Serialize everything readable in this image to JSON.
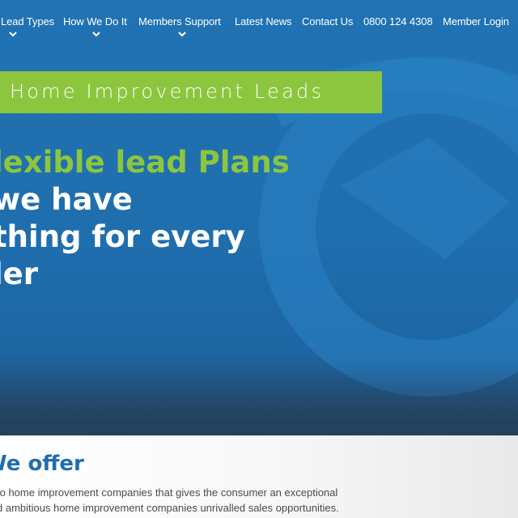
{
  "nav": {
    "items": [
      {
        "label": "Lead Types",
        "has_dropdown": true
      },
      {
        "label": "How We Do It",
        "has_dropdown": true
      },
      {
        "label": "Members Support",
        "has_dropdown": true
      },
      {
        "label": "Latest News",
        "has_dropdown": false
      },
      {
        "label": "Contact Us",
        "has_dropdown": false
      },
      {
        "label": "0800 124 4308",
        "has_dropdown": false
      },
      {
        "label": "Member Login",
        "has_dropdown": false
      }
    ]
  },
  "hero": {
    "banner": "Home Improvement Leads",
    "headline_line1": "lexible lead Plans",
    "headline_line2": " we have",
    "headline_line3": "thing for every",
    "headline_line4": "ler"
  },
  "offer": {
    "title": "e offer",
    "line1": "to home improvement companies that gives the consumer an exceptional",
    "line2": "d ambitious home improvement companies unrivalled sales opportunities."
  },
  "colors": {
    "hero_blue": "#2173b3",
    "accent_green": "#8cc63f",
    "title_blue": "#1f6eae"
  },
  "icons": {
    "background_mark": "swirl-logo-icon",
    "dropdown": "chevron-down-icon"
  }
}
